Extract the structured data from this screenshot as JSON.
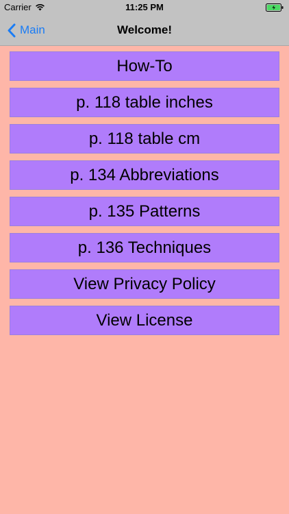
{
  "status_bar": {
    "carrier": "Carrier",
    "wifi_icon": "wifi-icon",
    "time": "11:25 PM",
    "battery_icon": "battery-charging-icon"
  },
  "nav": {
    "back_label": "Main",
    "back_icon": "chevron-left-icon",
    "title": "Welcome!"
  },
  "menu": {
    "items": [
      {
        "label": "How-To"
      },
      {
        "label": "p. 118 table inches"
      },
      {
        "label": "p. 118 table cm"
      },
      {
        "label": "p. 134 Abbreviations"
      },
      {
        "label": "p. 135 Patterns"
      },
      {
        "label": "p. 136 Techniques"
      },
      {
        "label": "View Privacy Policy"
      },
      {
        "label": "View License"
      }
    ]
  },
  "colors": {
    "background": "#feb6a8",
    "button_fill": "#b07cfb",
    "bar": "#c2c2c2",
    "accent": "#1a7cf5",
    "battery": "#4cd964"
  }
}
